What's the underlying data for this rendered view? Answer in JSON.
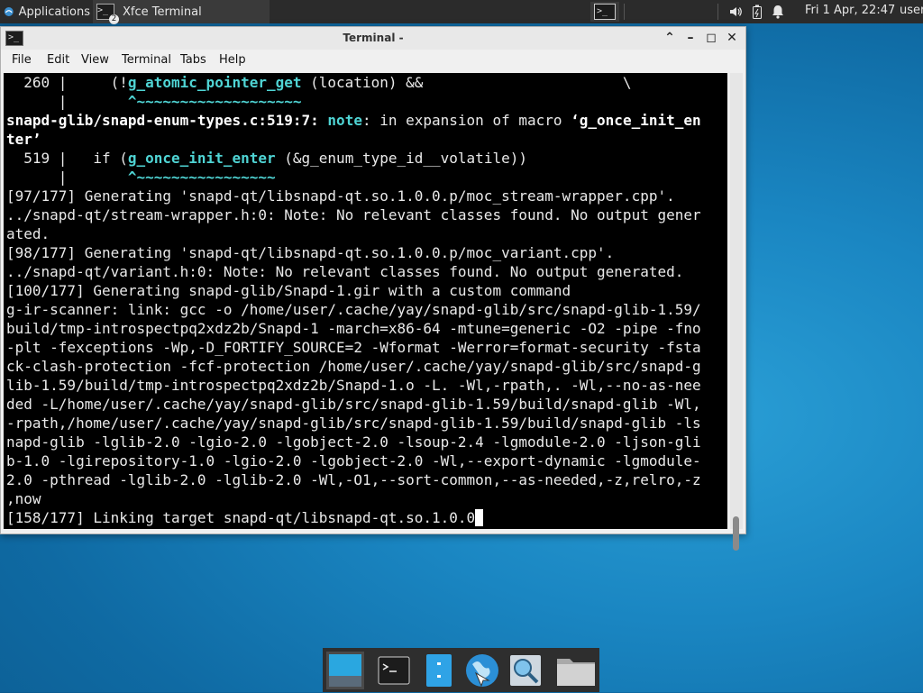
{
  "top_panel": {
    "applications_label": "Applications",
    "task_label": "Xfce Terminal",
    "clock": "Fri  1 Apr, 22:47",
    "user": "user"
  },
  "window": {
    "title": "Terminal -",
    "menu": [
      "File",
      "Edit",
      "View",
      "Terminal",
      "Tabs",
      "Help"
    ]
  },
  "terminal_lines": [
    "  260 |     (!g_atomic_pointer_get (location) &&                       \\",
    "      |       ^~~~~~~~~~~~~~~~~~~~",
    "snapd-glib/snapd-enum-types.c:519:7: note: in expansion of macro ‘g_once_init_en",
    "ter’",
    "  519 |   if (g_once_init_enter (&g_enum_type_id__volatile))",
    "      |       ^~~~~~~~~~~~~~~~~",
    "[97/177] Generating 'snapd-qt/libsnapd-qt.so.1.0.0.p/moc_stream-wrapper.cpp'.",
    "../snapd-qt/stream-wrapper.h:0: Note: No relevant classes found. No output gener",
    "ated.",
    "[98/177] Generating 'snapd-qt/libsnapd-qt.so.1.0.0.p/moc_variant.cpp'.",
    "../snapd-qt/variant.h:0: Note: No relevant classes found. No output generated.",
    "[100/177] Generating snapd-glib/Snapd-1.gir with a custom command",
    "g-ir-scanner: link: gcc -o /home/user/.cache/yay/snapd-glib/src/snapd-glib-1.59/",
    "build/tmp-introspectpq2xdz2b/Snapd-1 -march=x86-64 -mtune=generic -O2 -pipe -fno",
    "-plt -fexceptions -Wp,-D_FORTIFY_SOURCE=2 -Wformat -Werror=format-security -fsta",
    "ck-clash-protection -fcf-protection /home/user/.cache/yay/snapd-glib/src/snapd-g",
    "lib-1.59/build/tmp-introspectpq2xdz2b/Snapd-1.o -L. -Wl,-rpath,. -Wl,--no-as-nee",
    "ded -L/home/user/.cache/yay/snapd-glib/src/snapd-glib-1.59/build/snapd-glib -Wl,",
    "-rpath,/home/user/.cache/yay/snapd-glib/src/snapd-glib-1.59/build/snapd-glib -ls",
    "napd-glib -lglib-2.0 -lgio-2.0 -lgobject-2.0 -lsoup-2.4 -lgmodule-2.0 -ljson-gli",
    "b-1.0 -lgirepository-1.0 -lgio-2.0 -lgobject-2.0 -Wl,--export-dynamic -lgmodule-",
    "2.0 -pthread -lglib-2.0 -lglib-2.0 -Wl,-O1,--sort-common,--as-needed,-z,relro,-z",
    ",now",
    "[158/177] Linking target snapd-qt/libsnapd-qt.so.1.0.0"
  ],
  "colors": {
    "terminal_bg": "#000000",
    "terminal_fg": "#e9e9e9",
    "highlight": "#4fd4d4",
    "panel": "#2b2b2b"
  },
  "dock_icons": [
    "show-desktop-icon",
    "terminal-icon",
    "file-manager-icon",
    "web-browser-icon",
    "search-icon",
    "folder-icon"
  ]
}
